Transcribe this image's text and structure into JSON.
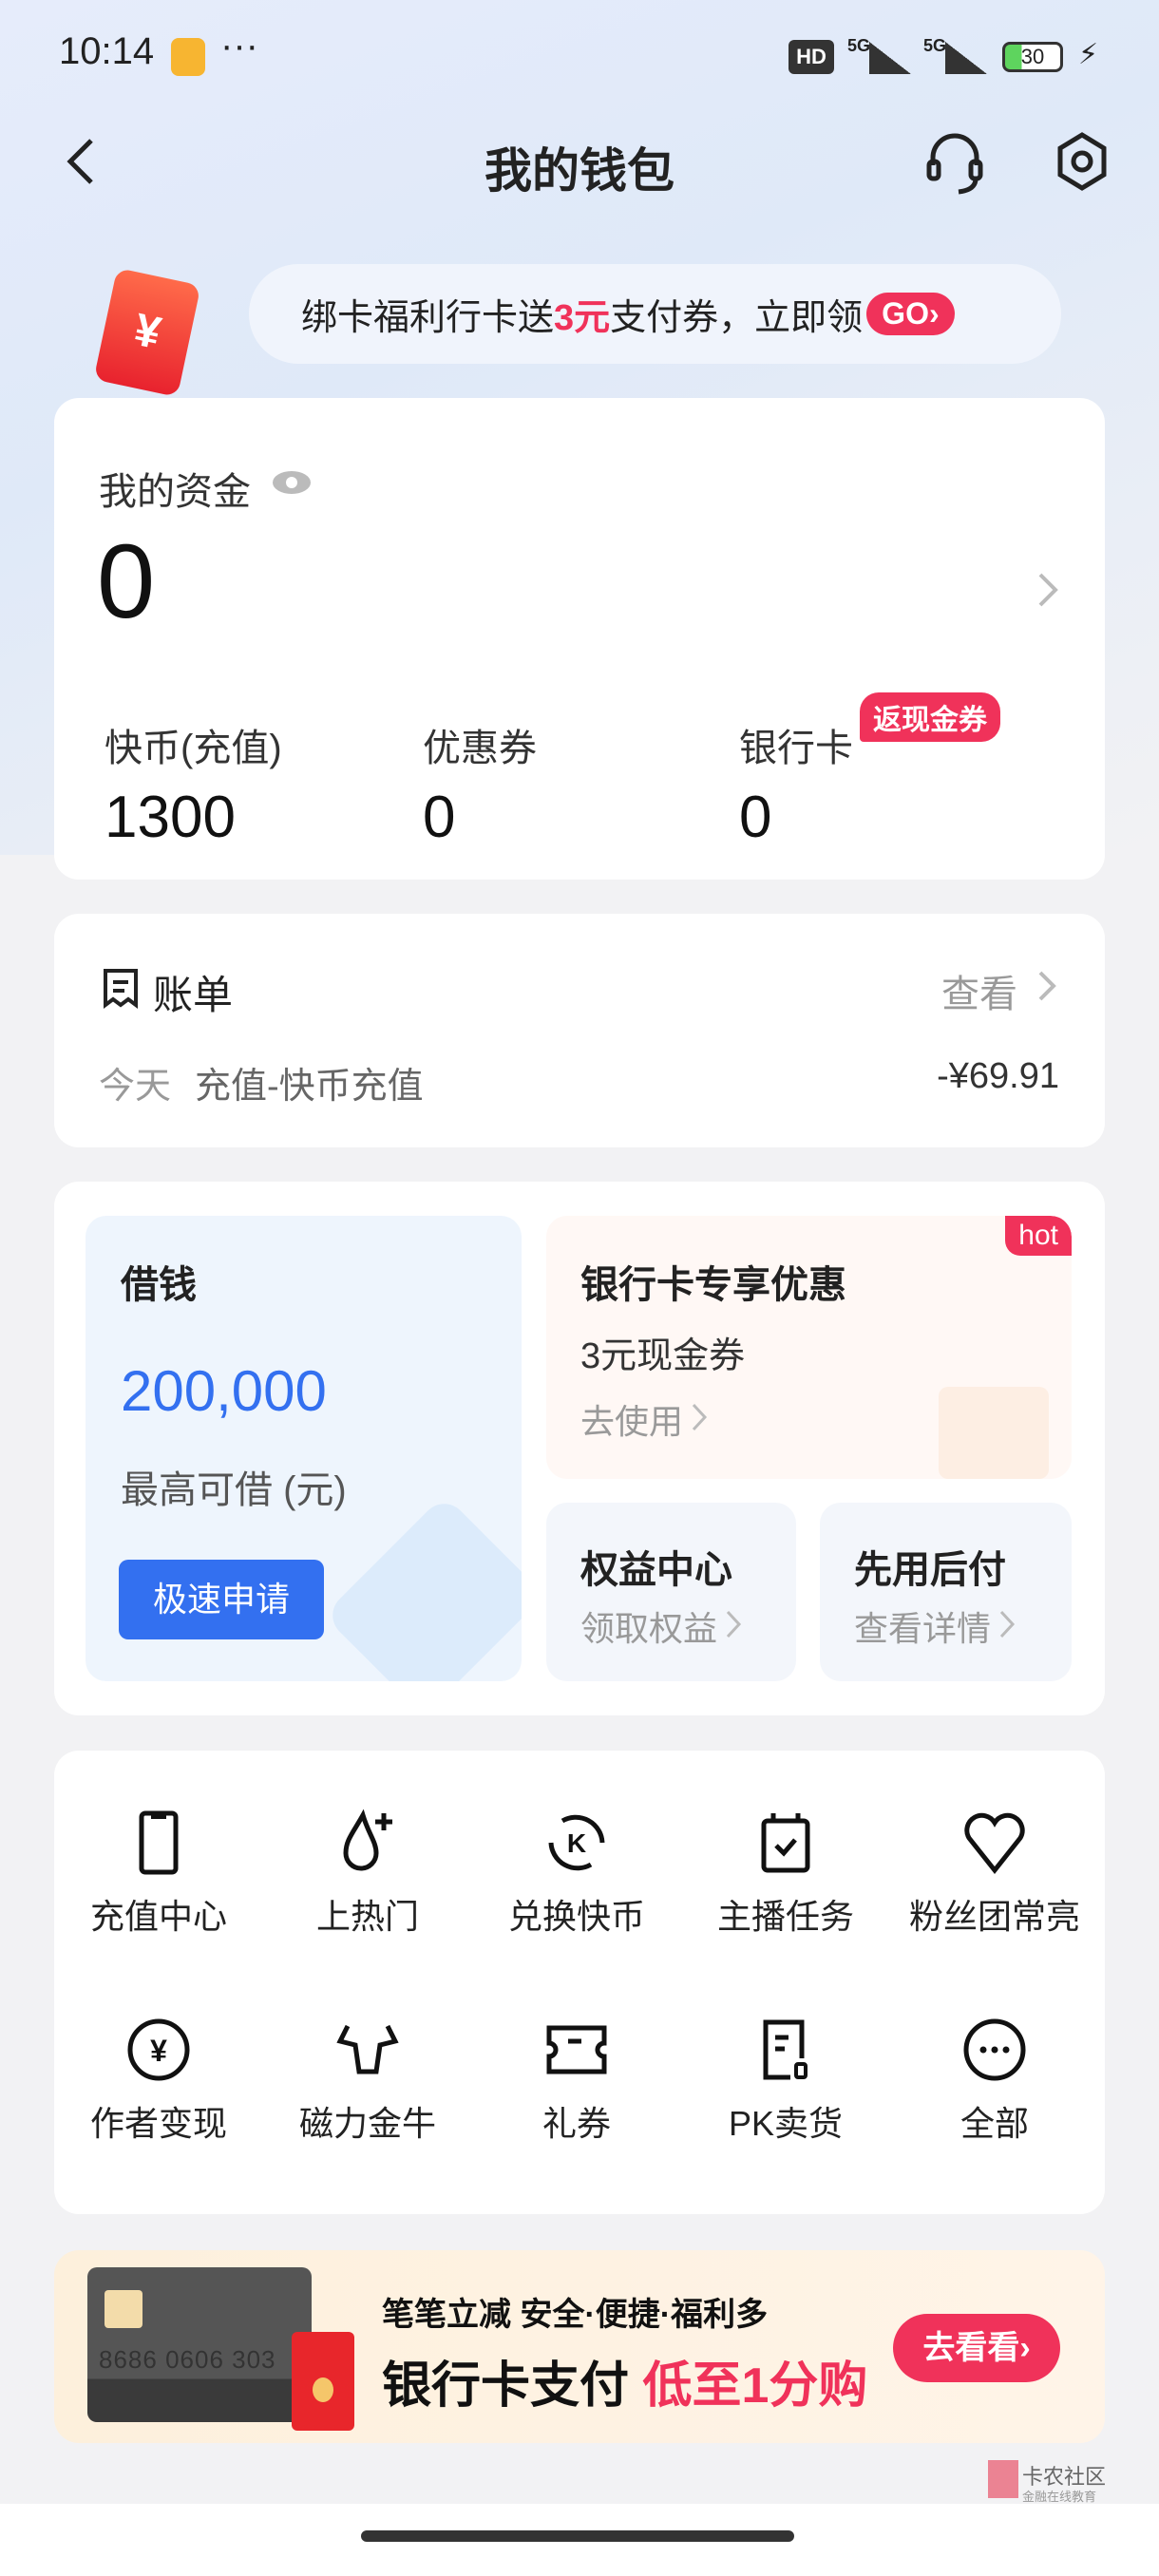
{
  "status_bar": {
    "time": "10:14",
    "dots": "···",
    "hd": "HD",
    "network1": "5G",
    "network2": "5G",
    "battery": "30"
  },
  "nav": {
    "title": "我的钱包"
  },
  "promo": {
    "text_before": "绑卡福利行卡送",
    "highlight": "3元",
    "text_after": "支付券，立即领",
    "go": "GO›"
  },
  "assets": {
    "label": "我的资金",
    "amount": "0",
    "items": [
      {
        "label": "快币(充值)",
        "value": "1300"
      },
      {
        "label": "优惠券",
        "value": "0"
      },
      {
        "label": "银行卡",
        "value": "0",
        "badge": "返现金券"
      }
    ]
  },
  "bill": {
    "title": "账单",
    "view": "查看",
    "date": "今天",
    "desc": "充值-快币充值",
    "amount": "-¥69.91"
  },
  "loan": {
    "title": "借钱",
    "amount": "200,000",
    "sub": "最高可借 (元)",
    "button": "极速申请"
  },
  "bank_offer": {
    "title": "银行卡专享优惠",
    "subtitle": "3元现金券",
    "link": "去使用",
    "badge": "hot"
  },
  "benefits": {
    "title": "权益中心",
    "link": "领取权益"
  },
  "bnpl": {
    "title": "先用后付",
    "link": "查看详情"
  },
  "grid": [
    {
      "label": "充值中心",
      "icon": "phone-icon"
    },
    {
      "label": "上热门",
      "icon": "flame-plus-icon"
    },
    {
      "label": "兑换快币",
      "icon": "exchange-coin-icon"
    },
    {
      "label": "主播任务",
      "icon": "calendar-check-icon"
    },
    {
      "label": "粉丝团常亮",
      "icon": "heart-icon"
    },
    {
      "label": "作者变现",
      "icon": "yuan-coin-icon"
    },
    {
      "label": "磁力金牛",
      "icon": "bull-icon"
    },
    {
      "label": "礼券",
      "icon": "ticket-icon"
    },
    {
      "label": "PK卖货",
      "icon": "document-icon"
    },
    {
      "label": "全部",
      "icon": "more-icon"
    }
  ],
  "banner": {
    "line1": "笔笔立减  安全·便捷·福利多",
    "line2_black": "银行卡支付",
    "line2_red": "低至1分购",
    "button": "去看看›",
    "card_number": "8686 0606 303"
  },
  "watermark": {
    "text": "卡农社区",
    "sub": "金融在线教育"
  },
  "colors": {
    "accent_blue": "#3370f0",
    "accent_red": "#f0325a"
  }
}
